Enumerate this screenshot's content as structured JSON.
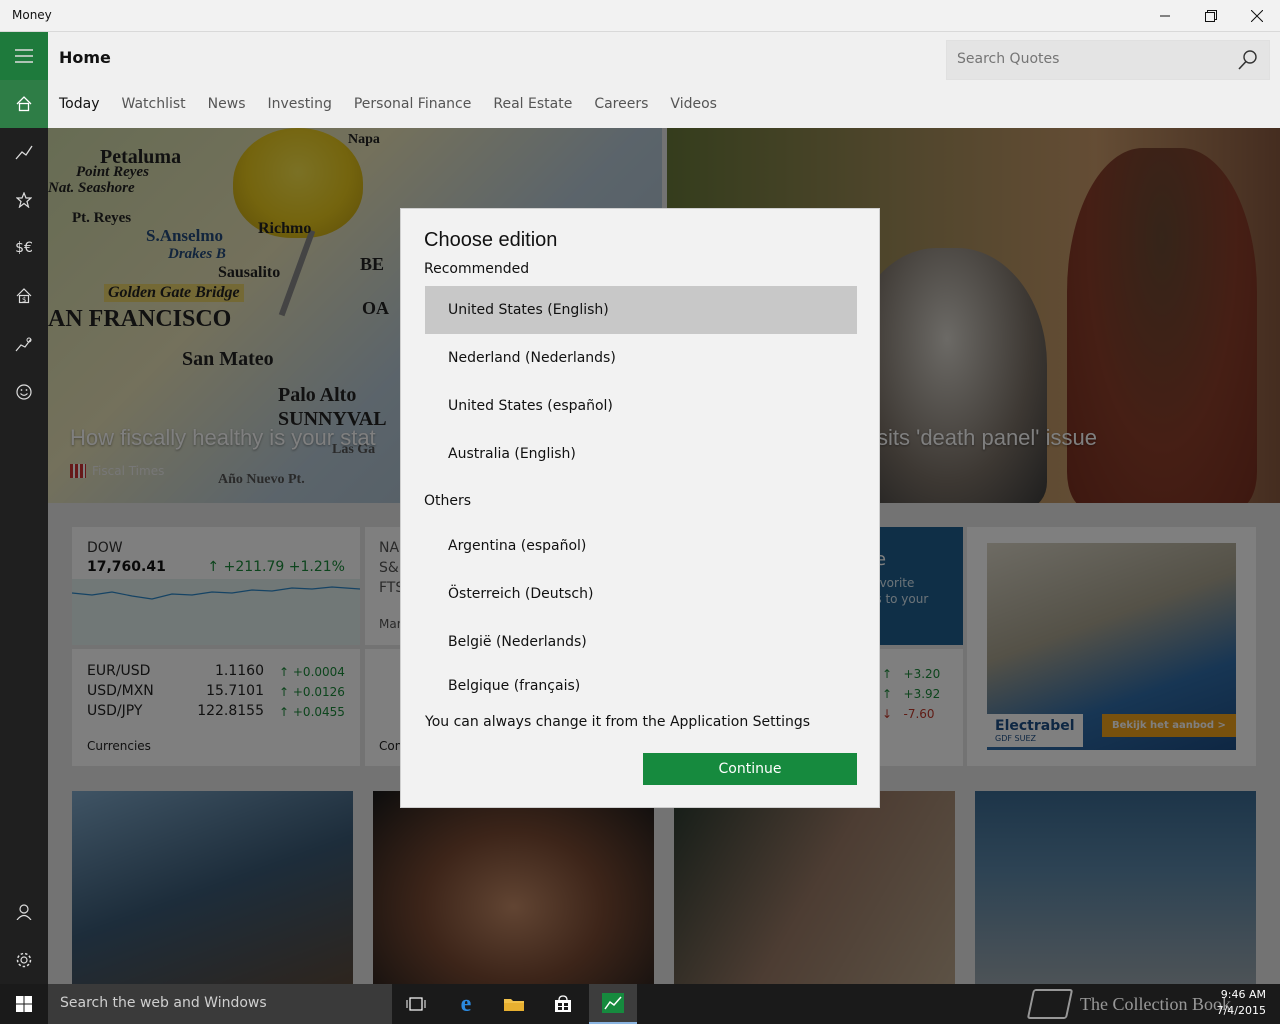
{
  "window": {
    "title": "Money"
  },
  "header": {
    "page_title": "Home",
    "search_placeholder": "Search Quotes",
    "tabs": [
      "Today",
      "Watchlist",
      "News",
      "Investing",
      "Personal Finance",
      "Real Estate",
      "Careers",
      "Videos"
    ]
  },
  "rail": {
    "items": [
      "hamburger-icon",
      "home-icon",
      "trending-icon",
      "star-icon",
      "currency-icon",
      "house-icon",
      "chart-icon",
      "smiley-icon",
      "account-icon",
      "settings-icon"
    ]
  },
  "hero": {
    "left_caption": "How fiscally healthy is your stat",
    "left_source": "Fiscal Times",
    "right_caption": "sits 'death panel' issue",
    "map_labels": [
      "Petaluma",
      "Point Reyes",
      "Nat. Seashore",
      "Pt. Reyes",
      "S.Anselmo",
      "Drakes B",
      "Sausalito",
      "Golden Gate Bridge",
      "AN FRANCISCO",
      "San Mateo",
      "Palo Alto",
      "SUNNYVAL",
      "Año Nuevo Pt.",
      "Napa",
      "Richmo",
      "BE",
      "OA",
      "Las Ga"
    ]
  },
  "markets": {
    "dow": {
      "label": "DOW",
      "value": "17,760.41",
      "change": "+211.79",
      "percent": "+1.21%"
    },
    "currencies": {
      "rows": [
        {
          "pair": "EUR/USD",
          "rate": "1.1160",
          "delta": "+0.0004"
        },
        {
          "pair": "USD/MXN",
          "rate": "15.7101",
          "delta": "+0.0126"
        },
        {
          "pair": "USD/JPY",
          "rate": "122.8155",
          "delta": "+0.0455"
        }
      ],
      "footer": "Currencies"
    },
    "indices_partial": [
      "NA",
      "S&",
      "FTS",
      "Mar"
    ],
    "indices_footer_partial": "Con",
    "promo": {
      "title": "te",
      "line1": "favorite",
      "line2": "es to your"
    },
    "stocks": [
      {
        "delta": "+3.20",
        "dir": "up"
      },
      {
        "delta": "+3.92",
        "dir": "up"
      },
      {
        "delta": "-7.60",
        "dir": "down"
      }
    ],
    "ad": {
      "brand": "Electrabel",
      "brand_sub": "GDF SUEZ",
      "cta": "Bekijk het aanbod  >"
    }
  },
  "dialog": {
    "title": "Choose edition",
    "recommended_label": "Recommended",
    "recommended": [
      "United States (English)",
      "Nederland (Nederlands)",
      "United States (español)",
      "Australia (English)"
    ],
    "others_label": "Others",
    "others": [
      "Argentina (español)",
      "Österreich (Deutsch)",
      "België (Nederlands)",
      "Belgique (français)"
    ],
    "note": "You can always change it from the Application Settings",
    "continue_label": "Continue",
    "selected": "United States (English)"
  },
  "taskbar": {
    "search_text": "Search the web and Windows",
    "time": "9:46 AM",
    "date": "7/4/2015",
    "watermark": "The Collection Book"
  },
  "colors": {
    "accent": "#168a3e",
    "rail_bg": "#1f1f1f",
    "positive": "#1b8a3a",
    "negative": "#c0392b"
  }
}
